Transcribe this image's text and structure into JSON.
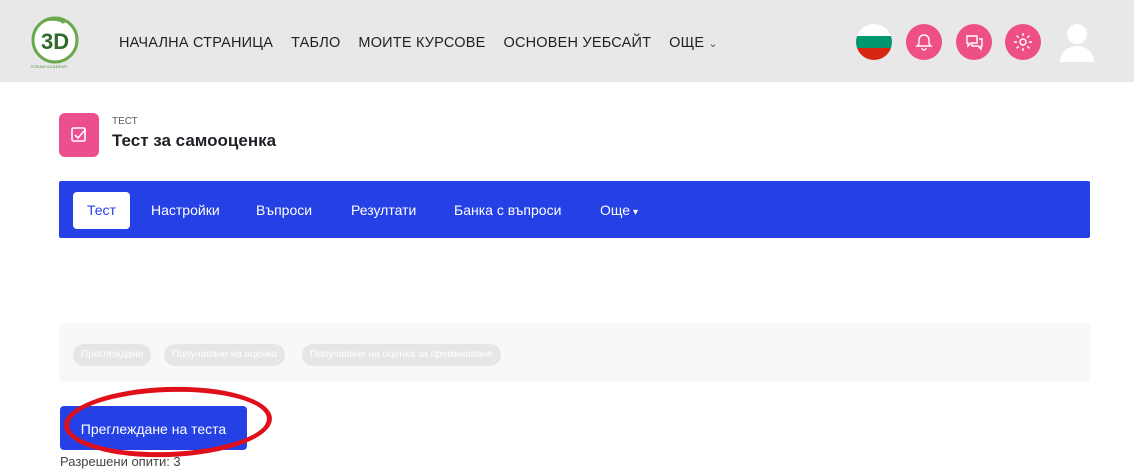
{
  "header": {
    "logo_caption": "STEAM ACADEMY",
    "nav": [
      {
        "label": "НАЧАЛНА СТРАНИЦА"
      },
      {
        "label": "ТАБЛО"
      },
      {
        "label": "МОИТЕ КУРСОВЕ"
      },
      {
        "label": "ОСНОВЕН УЕБСАЙТ"
      },
      {
        "label": "ОЩЕ"
      }
    ],
    "icons": [
      "bulgarian-flag-icon",
      "notifications-bell-icon",
      "messages-icon",
      "settings-gear-icon",
      "user-avatar-icon"
    ],
    "accent_color": "#ee4f86"
  },
  "activity": {
    "type": "ТЕСТ",
    "title": "Тест за самооценка"
  },
  "tabs": [
    {
      "label": "Тест",
      "active": true
    },
    {
      "label": "Настройки"
    },
    {
      "label": "Въпроси"
    },
    {
      "label": "Резултати"
    },
    {
      "label": "Банка с въпроси"
    },
    {
      "label": "Още"
    }
  ],
  "completion_chips": [
    "Преглеждане",
    "Получаване на оценка",
    "Получаване на оценка за преминаване"
  ],
  "preview_button": "Преглеждане на теста",
  "attempts_text": "Разрешени опити: 3",
  "colors": {
    "primary": "#2540e5",
    "activity_icon": "#ec4f8e",
    "annotation": "#e0101a"
  }
}
